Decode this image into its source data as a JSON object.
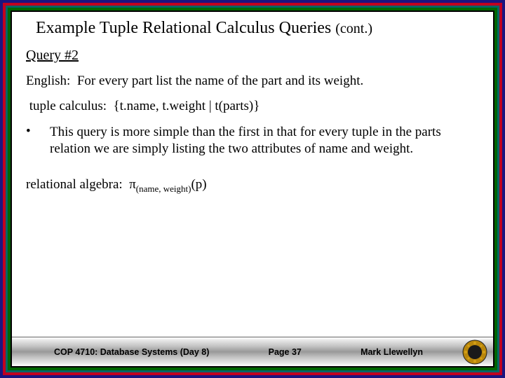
{
  "title": {
    "main": "Example Tuple Relational Calculus Queries",
    "cont": "(cont.)"
  },
  "heading": "Query #2",
  "english_label": "English:",
  "english_text": "For every part list the name of the part and its weight.",
  "tuple_label": "tuple calculus:",
  "tuple_expr": "{t.name, t.weight | t(parts)}",
  "bullet": "This query is more simple than the first in that for every tuple in the parts relation we are simply listing the two attributes of name and weight.",
  "ra_label": "relational algebra:",
  "ra_pi": "π",
  "ra_sub": "(name, weight)",
  "ra_tail": "(p)",
  "footer": {
    "left": "COP 4710: Database Systems (Day 8)",
    "center": "Page 37",
    "right": "Mark Llewellyn"
  }
}
